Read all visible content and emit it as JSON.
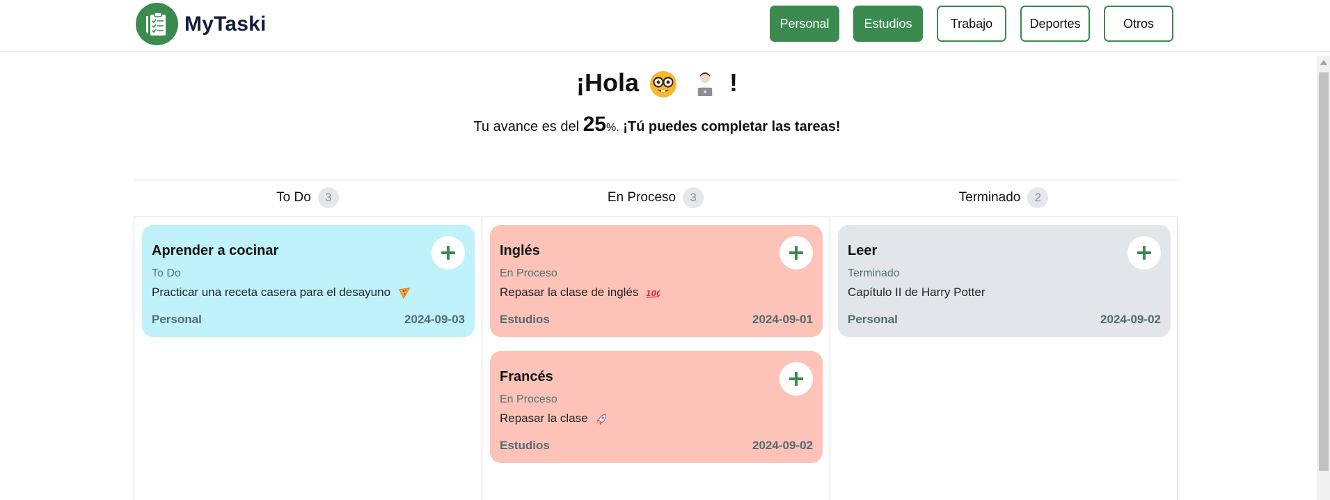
{
  "header": {
    "brand": "MyTaski",
    "nav": [
      {
        "label": "Personal",
        "active": true
      },
      {
        "label": "Estudios",
        "active": true
      },
      {
        "label": "Trabajo",
        "active": false
      },
      {
        "label": "Deportes",
        "active": false
      },
      {
        "label": "Otros",
        "active": false
      }
    ]
  },
  "greeting": {
    "hola": "¡Hola",
    "exclaim": "!",
    "progress_prefix": "Tu avance es del",
    "progress_value": "25",
    "progress_suffix": "%.",
    "cheer": "¡Tú puedes completar las tareas!"
  },
  "columns": [
    {
      "title": "To Do",
      "count": "3"
    },
    {
      "title": "En Proceso",
      "count": "3"
    },
    {
      "title": "Terminado",
      "count": "2"
    }
  ],
  "cards": {
    "todo": [
      {
        "title": "Aprender a cocinar",
        "status": "To Do",
        "desc": "Practicar una receta casera para el desayuno",
        "emoji": "pizza-icon",
        "category": "Personal",
        "date": "2024-09-03"
      }
    ],
    "proc": [
      {
        "title": "Inglés",
        "status": "En Proceso",
        "desc": "Repasar la clase de inglés",
        "emoji": "hundred-points-icon",
        "category": "Estudios",
        "date": "2024-09-01"
      },
      {
        "title": "Francés",
        "status": "En Proceso",
        "desc": "Repasar la clase",
        "emoji": "rocket-icon",
        "category": "Estudios",
        "date": "2024-09-02"
      }
    ],
    "done": [
      {
        "title": "Leer",
        "status": "Terminado",
        "desc": "Capítulo II de Harry Potter",
        "category": "Personal",
        "date": "2024-09-02"
      }
    ]
  },
  "colors": {
    "accent": "#3b8a4f",
    "todo": "#c0f2fb",
    "proc": "#fdc3b8",
    "done": "#e3e6e9",
    "brand_text": "#121c3d"
  }
}
